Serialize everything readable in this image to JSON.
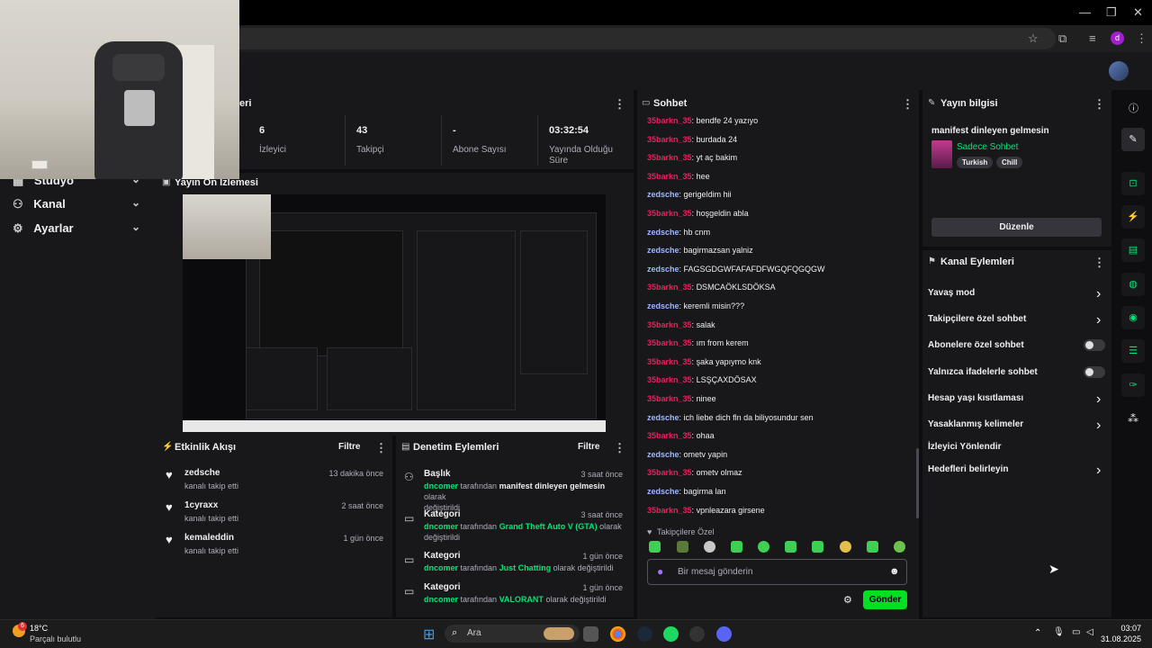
{
  "stats": [
    {
      "value": "6",
      "label": "İzleyici"
    },
    {
      "value": "43",
      "label": "Takipçi"
    },
    {
      "value": "-",
      "label": "Abone Sayısı"
    },
    {
      "value": "03:32:54",
      "label": "Yayında Olduğu Süre"
    }
  ],
  "sidebar": {
    "items": [
      {
        "label": "Stüdyo",
        "icon": "studio-icon"
      },
      {
        "label": "Kanal",
        "icon": "channel-icon"
      },
      {
        "label": "Ayarlar",
        "icon": "gear-icon"
      }
    ]
  },
  "stats_panel_title_fragment": "eri",
  "preview": {
    "title": "Yayın Ön İzlemesi"
  },
  "activity": {
    "title": "Etkinlik Akışı",
    "filter": "Filtre",
    "items": [
      {
        "name": "zedsche",
        "desc": "kanalı takip etti",
        "time": "13 dakika önce"
      },
      {
        "name": "1cyraxx",
        "desc": "kanalı takip etti",
        "time": "2 saat önce"
      },
      {
        "name": "kemaleddin",
        "desc": "kanalı takip etti",
        "time": "1 gün önce"
      }
    ]
  },
  "moderation": {
    "title": "Denetim Eylemleri",
    "filter": "Filtre",
    "items": [
      {
        "title": "Başlık",
        "time": "3 saat önce",
        "user": "dncomer",
        "mid": "tarafından",
        "value": "manifest dinleyen gelmesin",
        "tail1": "olarak",
        "tail2": "değiştirildi"
      },
      {
        "title": "Kategori",
        "time": "3 saat önce",
        "user": "dncomer",
        "mid": "tarafından",
        "value": "Grand Theft Auto V (GTA)",
        "tail1": "olarak",
        "tail2": "değiştirildi"
      },
      {
        "title": "Kategori",
        "time": "1 gün önce",
        "user": "dncomer",
        "mid": "tarafından",
        "value": "Just Chatting",
        "tail1": "olarak değiştirildi",
        "tail2": ""
      },
      {
        "title": "Kategori",
        "time": "1 gün önce",
        "user": "dncomer",
        "mid": "tarafından",
        "value": "VALORANT",
        "tail1": "olarak değiştirildi",
        "tail2": ""
      }
    ]
  },
  "chat": {
    "title": "Sohbet",
    "messages": [
      {
        "user": "35barkn_35",
        "text": "bendfe 24 yazıyo",
        "color": "red"
      },
      {
        "user": "35barkn_35",
        "text": "burdada 24",
        "color": "red"
      },
      {
        "user": "35barkn_35",
        "text": "yt aç bakim",
        "color": "red"
      },
      {
        "user": "35barkn_35",
        "text": "hee",
        "color": "red"
      },
      {
        "user": "zedsche",
        "text": "gerigeldim hii",
        "color": "blue"
      },
      {
        "user": "35barkn_35",
        "text": "hoşgeldin abla",
        "color": "red"
      },
      {
        "user": "zedsche",
        "text": "hb cnm",
        "color": "blue"
      },
      {
        "user": "zedsche",
        "text": "bagirmazsan yalniz",
        "color": "blue"
      },
      {
        "user": "zedsche",
        "text": "FAGSGDGWFAFAFDFWGQFQGQGW",
        "color": "blue"
      },
      {
        "user": "35barkn_35",
        "text": "DSMCAÖKLSDÖKSA",
        "color": "red"
      },
      {
        "user": "zedsche",
        "text": "keremli misin???",
        "color": "blue"
      },
      {
        "user": "35barkn_35",
        "text": "salak",
        "color": "red"
      },
      {
        "user": "35barkn_35",
        "text": "ım from kerem",
        "color": "red"
      },
      {
        "user": "35barkn_35",
        "text": "şaka yapıymo knk",
        "color": "red"
      },
      {
        "user": "35barkn_35",
        "text": "LSŞÇAXDÖSAX",
        "color": "red"
      },
      {
        "user": "35barkn_35",
        "text": "ninee",
        "color": "red"
      },
      {
        "user": "zedsche",
        "text": "ich liebe dich fln da biliyosundur sen",
        "color": "blue"
      },
      {
        "user": "35barkn_35",
        "text": "ohaa",
        "color": "red"
      },
      {
        "user": "zedsche",
        "text": "ometv yapin",
        "color": "blue"
      },
      {
        "user": "35barkn_35",
        "text": "ometv olmaz",
        "color": "red"
      },
      {
        "user": "zedsche",
        "text": "bagirma lan",
        "color": "blue"
      },
      {
        "user": "35barkn_35",
        "text": "vpnleazara girsene",
        "color": "red"
      }
    ],
    "mode_label": "Takipçilere Özel",
    "placeholder": "Bir mesaj gönderin",
    "send": "Gönder"
  },
  "stream_info": {
    "title": "Yayın bilgisi",
    "stream_title": "manifest dinleyen gelmesin",
    "category": "Sadece Sohbet",
    "tags": [
      "Turkish",
      "Chill"
    ],
    "edit": "Düzenle"
  },
  "channel_actions": {
    "title": "Kanal Eylemleri",
    "items": [
      {
        "label": "Yavaş mod",
        "type": "chevron"
      },
      {
        "label": "Takipçilere özel sohbet",
        "type": "chevron"
      },
      {
        "label": "Abonelere özel sohbet",
        "type": "toggle"
      },
      {
        "label": "Yalnızca ifadelerle sohbet",
        "type": "toggle"
      },
      {
        "label": "Hesap yaşı kısıtlaması",
        "type": "chevron"
      },
      {
        "label": "Yasaklanmış kelimeler",
        "type": "chevron"
      },
      {
        "label": "İzleyici Yönlendir",
        "type": "none"
      },
      {
        "label": "Hedefleri belirleyin",
        "type": "chevron"
      }
    ]
  },
  "taskbar": {
    "weather_temp": "18°C",
    "weather_desc": "Parçalı bulutlu",
    "weather_badge": "6",
    "search": "Ara",
    "time": "03:07",
    "date": "31.08.2025"
  },
  "browser": {
    "profile_initial": "d"
  },
  "colors": {
    "accent": "#00e676",
    "send": "#00e021",
    "chat_red": "#e0245e",
    "chat_blue": "#9fb7ff"
  }
}
